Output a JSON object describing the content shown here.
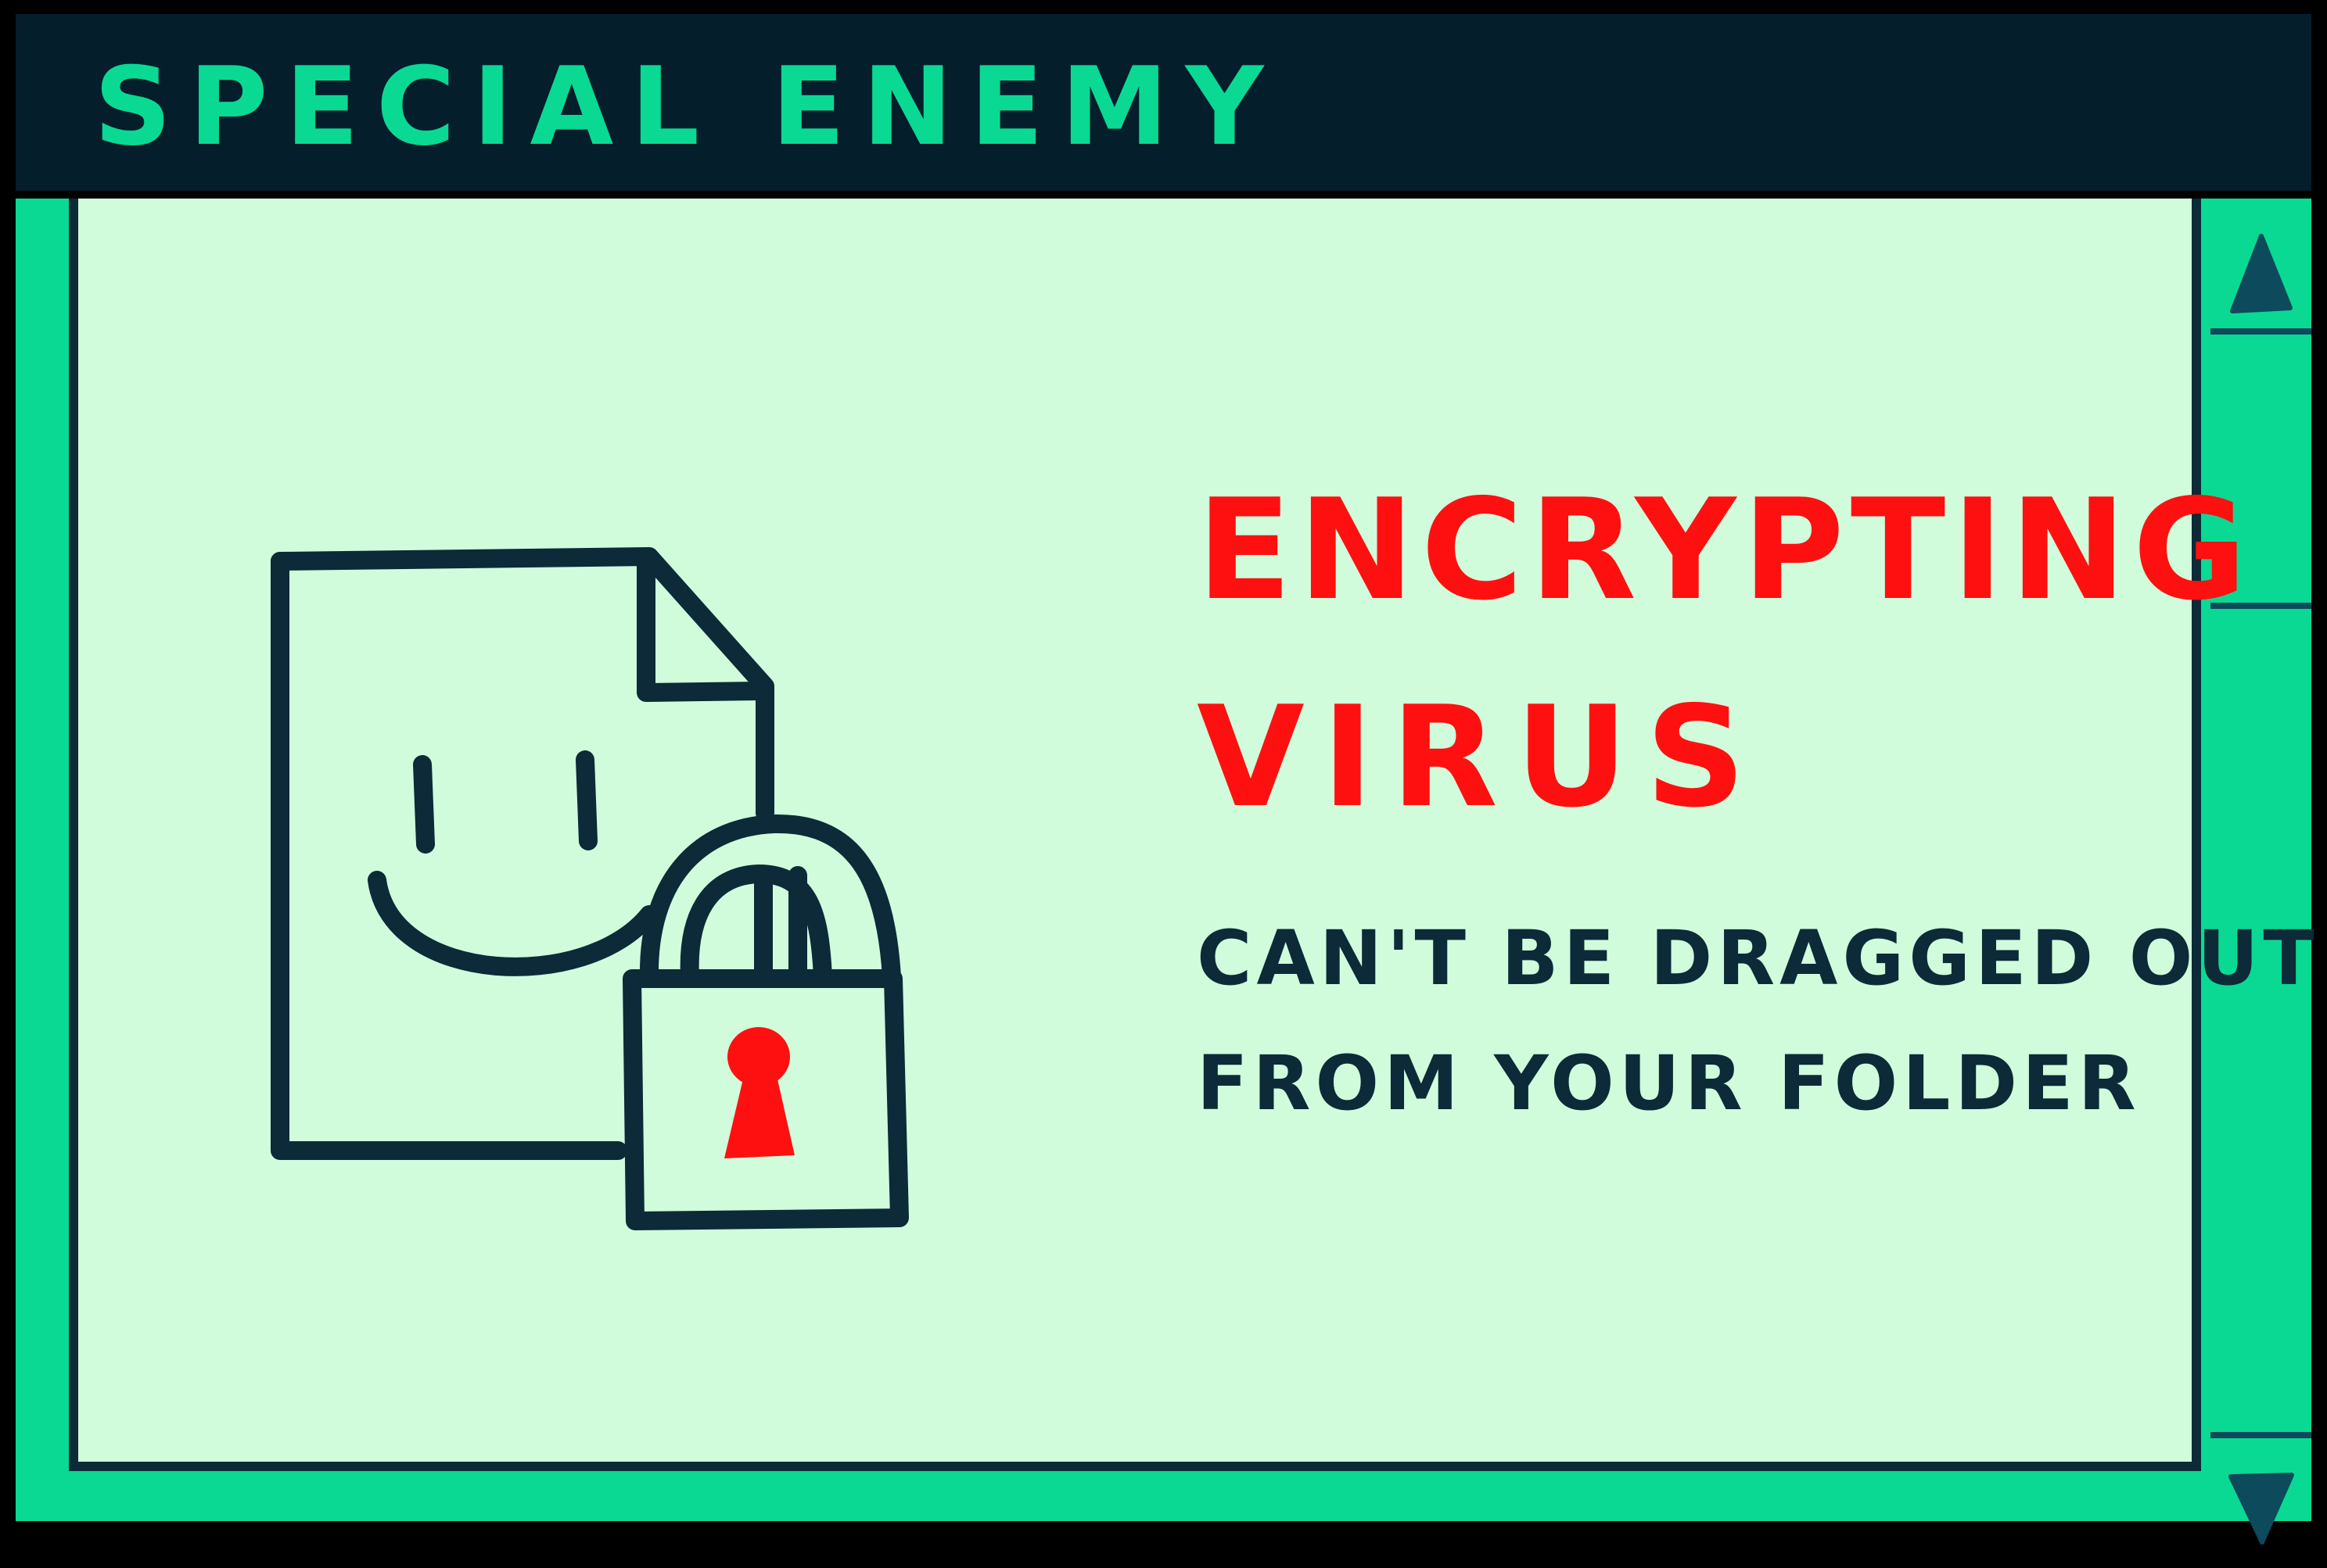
{
  "window": {
    "title": "SPECIAL ENEMY"
  },
  "card": {
    "heading_line1": "ENCRYPTING",
    "heading_line2": "VIRUS",
    "description_line1": "CAN'T BE DRAGGED OUT",
    "description_line2": "FROM YOUR FOLDER"
  },
  "icons": {
    "illustration": "locked-file-icon",
    "scroll_up": "triangle-up-icon",
    "scroll_down": "triangle-down-icon"
  },
  "colors": {
    "titlebar_bg": "#041e2c",
    "title_text": "#0ad993",
    "frame": "#0ad993",
    "content_bg": "#d0fcdc",
    "ink": "#0c2a38",
    "accent_red": "#ff1010"
  }
}
